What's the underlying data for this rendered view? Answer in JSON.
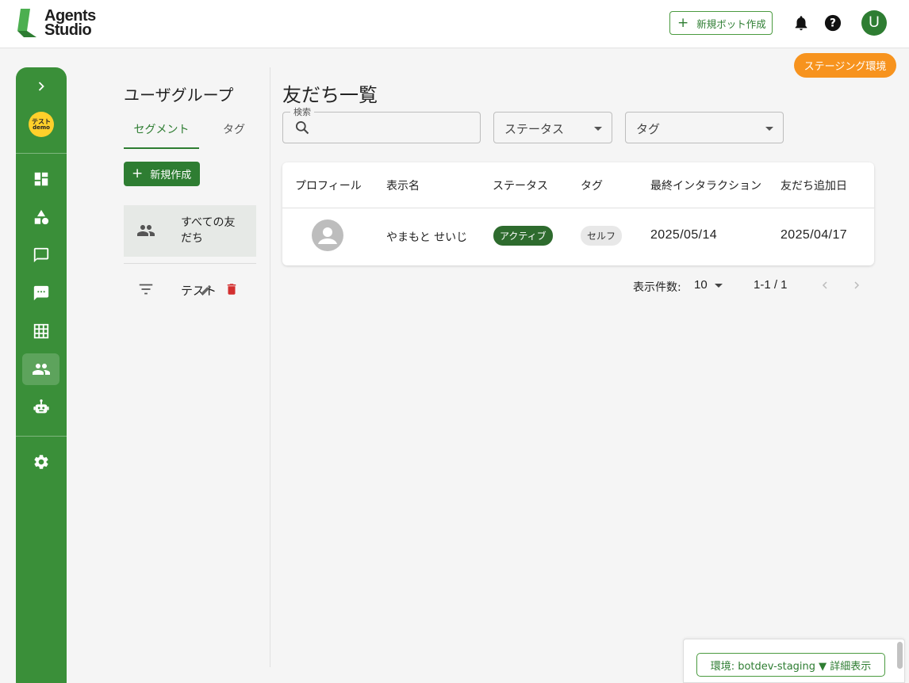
{
  "header": {
    "logo_line1": "Agents",
    "logo_line2": "Studio",
    "new_bot_label": "新規ボット作成",
    "user_initial": "U"
  },
  "env_badge": "ステージング環境",
  "rail": {
    "org_line1": "テスト",
    "org_line2": "demo",
    "items": [
      "chevron-right-icon",
      "dashboard-icon",
      "shapes-icon",
      "chat-bubble-icon",
      "chat-dots-icon",
      "grid-icon",
      "people-icon",
      "bot-icon",
      "settings-icon"
    ],
    "active": "people-icon"
  },
  "groups": {
    "title": "ユーザグループ",
    "tabs": [
      "セグメント",
      "タグ"
    ],
    "active_tab": "セグメント",
    "create_label": "新規作成",
    "items": [
      {
        "label": "すべての友だち",
        "icon": "people-icon"
      },
      {
        "label": "テスト",
        "icon": "filter-icon"
      }
    ]
  },
  "main": {
    "title": "友だち一覧",
    "search_legend": "検索",
    "status_placeholder": "ステータス",
    "tag_placeholder": "タグ"
  },
  "table": {
    "columns": [
      "プロフィール",
      "表示名",
      "ステータス",
      "タグ",
      "最終インタラクション",
      "友だち追加日"
    ],
    "rows": [
      {
        "display_name": "やまもと せいじ",
        "status": "アクティブ",
        "tag": "セルフ",
        "last_interaction": "2025/05/14",
        "added_date": "2025/04/17"
      }
    ]
  },
  "pager": {
    "rows_label": "表示件数:",
    "rows_per_page": "10",
    "range": "1-1 / 1"
  },
  "env_panel": {
    "text": "環境: botdev-staging ▼ 詳細表示"
  },
  "colors": {
    "brand": "#3a8f39",
    "accent": "#2e7d32",
    "badge": "#f7931e",
    "delete": "#d32f2f"
  }
}
